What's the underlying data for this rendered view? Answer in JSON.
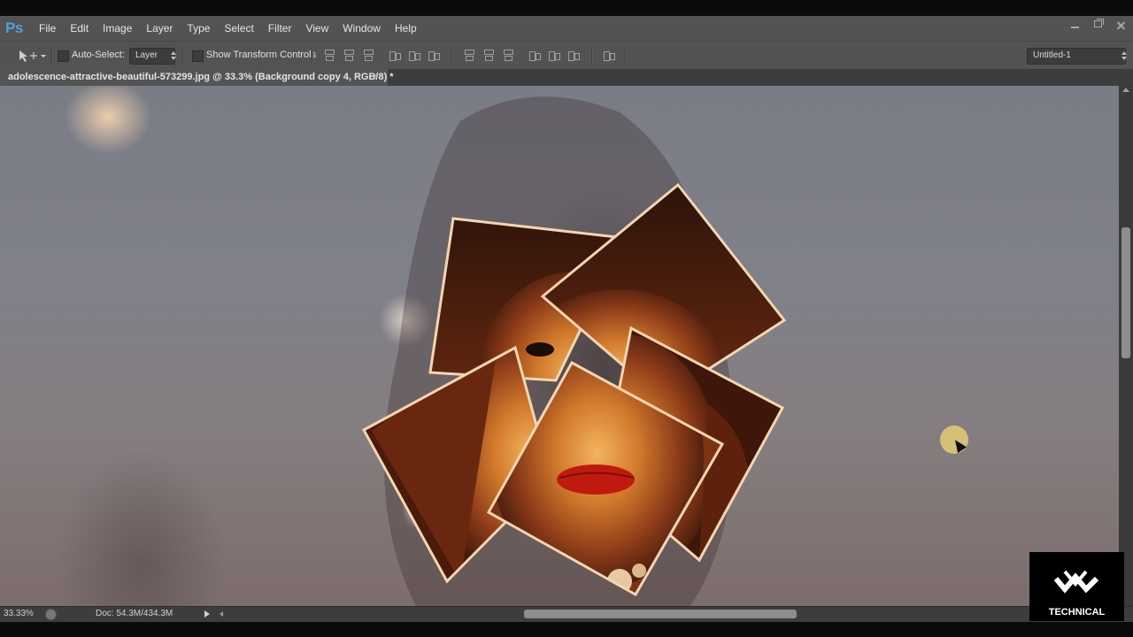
{
  "app": {
    "logo": "Ps"
  },
  "menu": [
    "File",
    "Edit",
    "Image",
    "Layer",
    "Type",
    "Select",
    "Filter",
    "View",
    "Window",
    "Help"
  ],
  "window_controls": [
    "minimize-icon",
    "restore-icon",
    "close-icon"
  ],
  "options_bar": {
    "auto_select_label": "Auto-Select:",
    "auto_select_checked": false,
    "auto_select_target": "Layer",
    "show_transform_label": "Show Transform Controls",
    "show_transform_checked": false,
    "workspace": "Untitled-1"
  },
  "document_tab": {
    "title": "adolescence-attractive-beautiful-573299.jpg @ 33.3% (Background copy 4, RGB/8) *",
    "close": "×"
  },
  "status_bar": {
    "zoom": "33.33%",
    "doc_size": "Doc: 54.3M/434.3M"
  },
  "watermark": {
    "text": "TECHNICAL"
  },
  "colors": {
    "panel_bg": "#535353",
    "tab_bg": "#3d3d3d",
    "frame_stroke": "#f2d6b0",
    "cursor_highlight": "#dec878"
  }
}
